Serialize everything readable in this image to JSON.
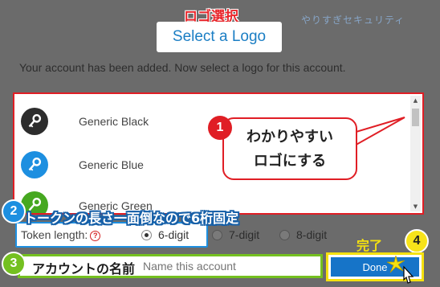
{
  "watermark": "やりすぎセキュリティ",
  "header": {
    "annotation": "ロゴ選択",
    "title": "Select a Logo",
    "subtitle": "Your account has been added. Now select a logo for this account."
  },
  "logo_list": {
    "items": [
      {
        "label": "Generic Black",
        "color": "#2d2d2d"
      },
      {
        "label": "Generic Blue",
        "color": "#1d8fe0"
      },
      {
        "label": "Generic Green",
        "color": "#46a820"
      }
    ],
    "scrollbar": {
      "up_arrow": "▲",
      "down_arrow": "▼"
    }
  },
  "callouts": {
    "badge_1": "1",
    "bubble_line_1": "わかりやすい",
    "bubble_line_2": "ロゴにする",
    "badge_2": "2",
    "token_note": "トークンの長さ一面倒なので6桁固定",
    "badge_3": "3",
    "name_note": "アカウントの名前",
    "badge_4": "4",
    "done_note": "完了"
  },
  "token_length": {
    "label": "Token length:",
    "help_icon": "?",
    "options": [
      {
        "label": "6-digit",
        "selected": true
      },
      {
        "label": "7-digit",
        "selected": false
      },
      {
        "label": "8-digit",
        "selected": false
      }
    ]
  },
  "account_name": {
    "placeholder": "Name this account"
  },
  "done_button": {
    "label": "Done"
  },
  "icons": {
    "logo": "key-icon",
    "sparkle": "sparkle-icon",
    "cursor": "cursor-icon"
  },
  "colors": {
    "red": "#e01e25",
    "blue": "#1d8fe0",
    "green": "#74c020",
    "yellow": "#f5e10f",
    "button": "#1674c8"
  }
}
